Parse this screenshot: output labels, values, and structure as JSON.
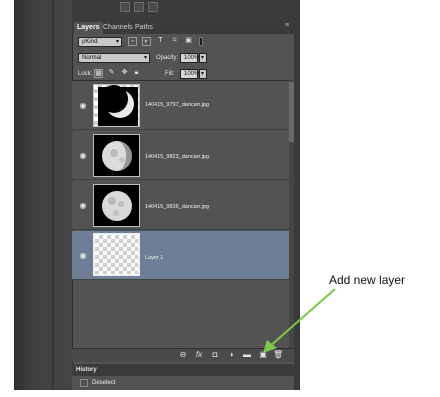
{
  "panel": {
    "tabs": [
      {
        "label": "Layers",
        "active": true
      },
      {
        "label": "Channels",
        "active": false
      },
      {
        "label": "Paths",
        "active": false
      }
    ],
    "filter_kind": "ρKind",
    "blend_mode": "Normal",
    "opacity_label": "Opacity:",
    "opacity_value": "100%",
    "lock_label": "Lock:",
    "fill_label": "Fill:",
    "fill_value": "100%"
  },
  "layers": [
    {
      "name": "140415_9797_dancarr.jpg",
      "thumbnail": "moon-crescent",
      "selected": false,
      "visible": true
    },
    {
      "name": "140415_9823_dancarr.jpg",
      "thumbnail": "moon-gibbous",
      "selected": false,
      "visible": true
    },
    {
      "name": "140415_9836_dancarr.jpg",
      "thumbnail": "moon-full",
      "selected": false,
      "visible": true
    },
    {
      "name": "Layer 1",
      "thumbnail": "transparent",
      "selected": true,
      "visible": true
    }
  ],
  "history": {
    "title": "History",
    "items": [
      {
        "label": "Deselect"
      }
    ]
  },
  "annotation": {
    "text": "Add new layer",
    "arrow_color": "#7dc84a"
  },
  "colors": {
    "selected_row": "#6d7e95",
    "panel_bg": "#535353"
  }
}
